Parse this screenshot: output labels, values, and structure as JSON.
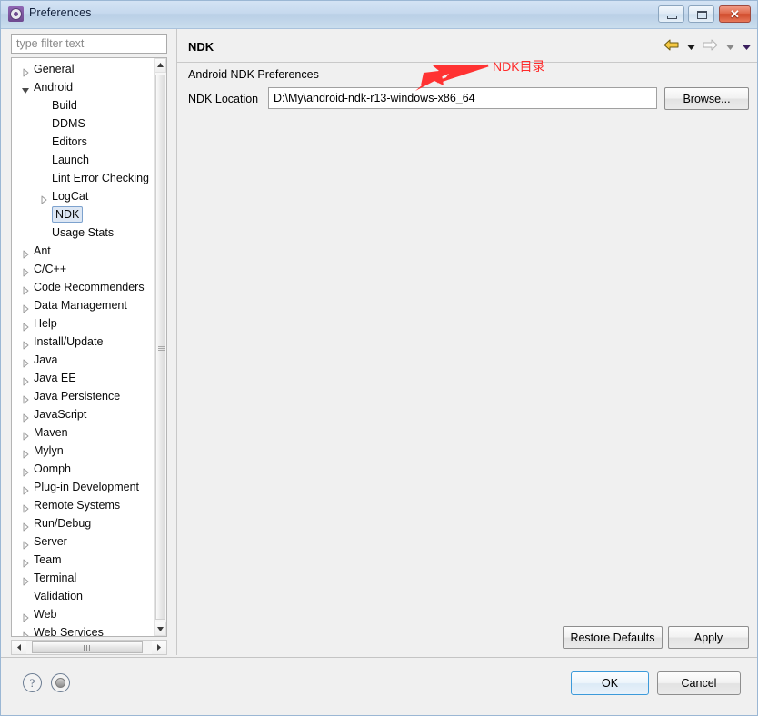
{
  "window": {
    "title": "Preferences",
    "icon": "gear-icon",
    "controls": {
      "minimize": "Minimize",
      "maximize": "Maximize",
      "close": "Close",
      "close_glyph": "✕"
    }
  },
  "sidebar": {
    "filter": {
      "placeholder": "type filter text",
      "value": ""
    },
    "items": [
      {
        "label": "General",
        "indent": 0,
        "state": "collapsed",
        "selected": false
      },
      {
        "label": "Android",
        "indent": 0,
        "state": "expanded",
        "selected": false
      },
      {
        "label": "Build",
        "indent": 1,
        "state": "leaf",
        "selected": false
      },
      {
        "label": "DDMS",
        "indent": 1,
        "state": "leaf",
        "selected": false
      },
      {
        "label": "Editors",
        "indent": 1,
        "state": "leaf",
        "selected": false
      },
      {
        "label": "Launch",
        "indent": 1,
        "state": "leaf",
        "selected": false
      },
      {
        "label": "Lint Error Checking",
        "indent": 1,
        "state": "leaf",
        "selected": false
      },
      {
        "label": "LogCat",
        "indent": 1,
        "state": "collapsed",
        "selected": false
      },
      {
        "label": "NDK",
        "indent": 1,
        "state": "leaf",
        "selected": true
      },
      {
        "label": "Usage Stats",
        "indent": 1,
        "state": "leaf",
        "selected": false
      },
      {
        "label": "Ant",
        "indent": 0,
        "state": "collapsed",
        "selected": false
      },
      {
        "label": "C/C++",
        "indent": 0,
        "state": "collapsed",
        "selected": false
      },
      {
        "label": "Code Recommenders",
        "indent": 0,
        "state": "collapsed",
        "selected": false
      },
      {
        "label": "Data Management",
        "indent": 0,
        "state": "collapsed",
        "selected": false
      },
      {
        "label": "Help",
        "indent": 0,
        "state": "collapsed",
        "selected": false
      },
      {
        "label": "Install/Update",
        "indent": 0,
        "state": "collapsed",
        "selected": false
      },
      {
        "label": "Java",
        "indent": 0,
        "state": "collapsed",
        "selected": false
      },
      {
        "label": "Java EE",
        "indent": 0,
        "state": "collapsed",
        "selected": false
      },
      {
        "label": "Java Persistence",
        "indent": 0,
        "state": "collapsed",
        "selected": false
      },
      {
        "label": "JavaScript",
        "indent": 0,
        "state": "collapsed",
        "selected": false
      },
      {
        "label": "Maven",
        "indent": 0,
        "state": "collapsed",
        "selected": false
      },
      {
        "label": "Mylyn",
        "indent": 0,
        "state": "collapsed",
        "selected": false
      },
      {
        "label": "Oomph",
        "indent": 0,
        "state": "collapsed",
        "selected": false
      },
      {
        "label": "Plug-in Development",
        "indent": 0,
        "state": "collapsed",
        "selected": false
      },
      {
        "label": "Remote Systems",
        "indent": 0,
        "state": "collapsed",
        "selected": false
      },
      {
        "label": "Run/Debug",
        "indent": 0,
        "state": "collapsed",
        "selected": false
      },
      {
        "label": "Server",
        "indent": 0,
        "state": "collapsed",
        "selected": false
      },
      {
        "label": "Team",
        "indent": 0,
        "state": "collapsed",
        "selected": false
      },
      {
        "label": "Terminal",
        "indent": 0,
        "state": "collapsed",
        "selected": false
      },
      {
        "label": "Validation",
        "indent": 0,
        "state": "leaf",
        "selected": false
      },
      {
        "label": "Web",
        "indent": 0,
        "state": "collapsed",
        "selected": false
      },
      {
        "label": "Web Services",
        "indent": 0,
        "state": "collapsed",
        "selected": false
      }
    ]
  },
  "page": {
    "title": "NDK",
    "group_label": "Android NDK Preferences",
    "field_label": "NDK Location",
    "ndk_location_value": "D:\\My\\android-ndk-r13-windows-x86_64",
    "browse_label": "Browse...",
    "restore_defaults_label": "Restore Defaults",
    "apply_label": "Apply",
    "nav": {
      "back": "back-arrow",
      "back_menu": "back-dropdown",
      "forward": "forward-arrow",
      "forward_menu": "forward-dropdown",
      "view_menu": "view-menu-dropdown"
    }
  },
  "annotation": {
    "text": "NDK目录",
    "color": "#ff2b2b",
    "arrow": "red-arrow-pointing-to-ndk-location"
  },
  "footer": {
    "help_icon": "help-icon",
    "shell_icon": "shell-status-icon",
    "ok_label": "OK",
    "cancel_label": "Cancel"
  },
  "colors": {
    "title_bar": "#c6d9ee",
    "selection_fill": "#dde7f4",
    "selection_border": "#7da2ce",
    "accent_default_button": "#3c9ada",
    "annotation_red": "#ff2b2b",
    "nav_back_gold": "#f5c842"
  }
}
